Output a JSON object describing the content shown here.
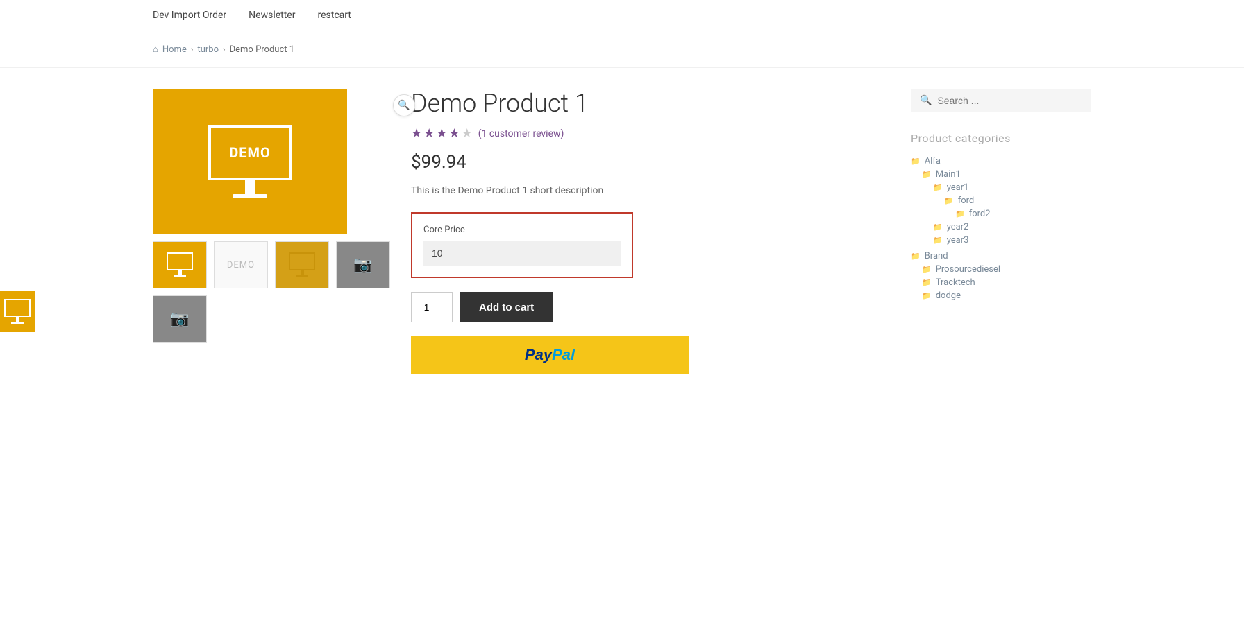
{
  "nav": {
    "links": [
      {
        "label": "Dev Import Order",
        "href": "#"
      },
      {
        "label": "Newsletter",
        "href": "#"
      },
      {
        "label": "restcart",
        "href": "#"
      }
    ]
  },
  "breadcrumb": {
    "home_label": "Home",
    "sep1": "›",
    "cat_label": "turbo",
    "sep2": "›",
    "current": "Demo Product 1"
  },
  "product": {
    "title": "Demo Product 1",
    "rating": 3.5,
    "review_text": "(1 customer review)",
    "price": "$99.94",
    "short_desc": "This is the Demo Product 1 short description",
    "core_price_label": "Core Price",
    "core_price_value": "10",
    "qty_value": "1",
    "add_to_cart_label": "Add to cart"
  },
  "sidebar": {
    "search_placeholder": "Search ...",
    "categories_title": "Product categories",
    "categories": [
      {
        "label": "Alfa",
        "children": [
          {
            "label": "Main1",
            "children": [
              {
                "label": "year1",
                "children": [
                  {
                    "label": "ford",
                    "children": [
                      {
                        "label": "ford2",
                        "children": []
                      }
                    ]
                  }
                ]
              },
              {
                "label": "year2",
                "children": []
              },
              {
                "label": "year3",
                "children": []
              }
            ]
          }
        ]
      },
      {
        "label": "Brand",
        "children": [
          {
            "label": "Prosourcediesel",
            "children": []
          },
          {
            "label": "Tracktech",
            "children": []
          },
          {
            "label": "dodge",
            "children": []
          }
        ]
      }
    ]
  }
}
